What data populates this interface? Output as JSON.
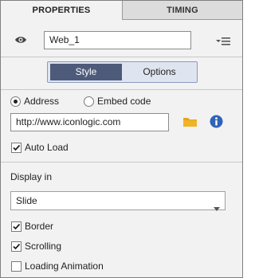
{
  "tabs": [
    {
      "label": "PROPERTIES",
      "active": true
    },
    {
      "label": "TIMING",
      "active": false
    }
  ],
  "object": {
    "visibility_icon": "eye-icon",
    "name": "Web_1",
    "menu_icon": "panel-menu-icon"
  },
  "segments": [
    {
      "label": "Style",
      "active": true
    },
    {
      "label": "Options",
      "active": false
    }
  ],
  "source": {
    "address_label": "Address",
    "embed_label": "Embed code",
    "selected": "Address",
    "url": "http://www.iconlogic.com",
    "folder_icon": "folder-icon",
    "info_icon": "info-icon"
  },
  "auto_load": {
    "label": "Auto Load",
    "checked": true
  },
  "display": {
    "label": "Display in",
    "selected": "Slide"
  },
  "options": [
    {
      "label": "Border",
      "checked": true
    },
    {
      "label": "Scrolling",
      "checked": true
    },
    {
      "label": "Loading Animation",
      "checked": false
    }
  ],
  "colors": {
    "segment_active": "#4d5a7a",
    "folder": "#e8a317",
    "info": "#2f63b7"
  }
}
